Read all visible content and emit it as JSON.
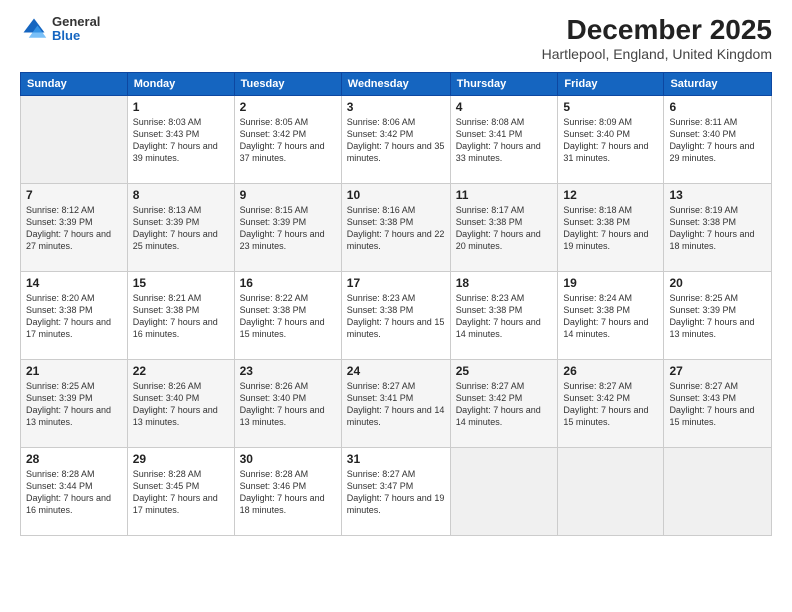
{
  "logo": {
    "general": "General",
    "blue": "Blue"
  },
  "title": "December 2025",
  "location": "Hartlepool, England, United Kingdom",
  "headers": [
    "Sunday",
    "Monday",
    "Tuesday",
    "Wednesday",
    "Thursday",
    "Friday",
    "Saturday"
  ],
  "weeks": [
    [
      {
        "day": "",
        "info": ""
      },
      {
        "day": "1",
        "info": "Sunrise: 8:03 AM\nSunset: 3:43 PM\nDaylight: 7 hours\nand 39 minutes."
      },
      {
        "day": "2",
        "info": "Sunrise: 8:05 AM\nSunset: 3:42 PM\nDaylight: 7 hours\nand 37 minutes."
      },
      {
        "day": "3",
        "info": "Sunrise: 8:06 AM\nSunset: 3:42 PM\nDaylight: 7 hours\nand 35 minutes."
      },
      {
        "day": "4",
        "info": "Sunrise: 8:08 AM\nSunset: 3:41 PM\nDaylight: 7 hours\nand 33 minutes."
      },
      {
        "day": "5",
        "info": "Sunrise: 8:09 AM\nSunset: 3:40 PM\nDaylight: 7 hours\nand 31 minutes."
      },
      {
        "day": "6",
        "info": "Sunrise: 8:11 AM\nSunset: 3:40 PM\nDaylight: 7 hours\nand 29 minutes."
      }
    ],
    [
      {
        "day": "7",
        "info": "Sunrise: 8:12 AM\nSunset: 3:39 PM\nDaylight: 7 hours\nand 27 minutes."
      },
      {
        "day": "8",
        "info": "Sunrise: 8:13 AM\nSunset: 3:39 PM\nDaylight: 7 hours\nand 25 minutes."
      },
      {
        "day": "9",
        "info": "Sunrise: 8:15 AM\nSunset: 3:39 PM\nDaylight: 7 hours\nand 23 minutes."
      },
      {
        "day": "10",
        "info": "Sunrise: 8:16 AM\nSunset: 3:38 PM\nDaylight: 7 hours\nand 22 minutes."
      },
      {
        "day": "11",
        "info": "Sunrise: 8:17 AM\nSunset: 3:38 PM\nDaylight: 7 hours\nand 20 minutes."
      },
      {
        "day": "12",
        "info": "Sunrise: 8:18 AM\nSunset: 3:38 PM\nDaylight: 7 hours\nand 19 minutes."
      },
      {
        "day": "13",
        "info": "Sunrise: 8:19 AM\nSunset: 3:38 PM\nDaylight: 7 hours\nand 18 minutes."
      }
    ],
    [
      {
        "day": "14",
        "info": "Sunrise: 8:20 AM\nSunset: 3:38 PM\nDaylight: 7 hours\nand 17 minutes."
      },
      {
        "day": "15",
        "info": "Sunrise: 8:21 AM\nSunset: 3:38 PM\nDaylight: 7 hours\nand 16 minutes."
      },
      {
        "day": "16",
        "info": "Sunrise: 8:22 AM\nSunset: 3:38 PM\nDaylight: 7 hours\nand 15 minutes."
      },
      {
        "day": "17",
        "info": "Sunrise: 8:23 AM\nSunset: 3:38 PM\nDaylight: 7 hours\nand 15 minutes."
      },
      {
        "day": "18",
        "info": "Sunrise: 8:23 AM\nSunset: 3:38 PM\nDaylight: 7 hours\nand 14 minutes."
      },
      {
        "day": "19",
        "info": "Sunrise: 8:24 AM\nSunset: 3:38 PM\nDaylight: 7 hours\nand 14 minutes."
      },
      {
        "day": "20",
        "info": "Sunrise: 8:25 AM\nSunset: 3:39 PM\nDaylight: 7 hours\nand 13 minutes."
      }
    ],
    [
      {
        "day": "21",
        "info": "Sunrise: 8:25 AM\nSunset: 3:39 PM\nDaylight: 7 hours\nand 13 minutes."
      },
      {
        "day": "22",
        "info": "Sunrise: 8:26 AM\nSunset: 3:40 PM\nDaylight: 7 hours\nand 13 minutes."
      },
      {
        "day": "23",
        "info": "Sunrise: 8:26 AM\nSunset: 3:40 PM\nDaylight: 7 hours\nand 13 minutes."
      },
      {
        "day": "24",
        "info": "Sunrise: 8:27 AM\nSunset: 3:41 PM\nDaylight: 7 hours\nand 14 minutes."
      },
      {
        "day": "25",
        "info": "Sunrise: 8:27 AM\nSunset: 3:42 PM\nDaylight: 7 hours\nand 14 minutes."
      },
      {
        "day": "26",
        "info": "Sunrise: 8:27 AM\nSunset: 3:42 PM\nDaylight: 7 hours\nand 15 minutes."
      },
      {
        "day": "27",
        "info": "Sunrise: 8:27 AM\nSunset: 3:43 PM\nDaylight: 7 hours\nand 15 minutes."
      }
    ],
    [
      {
        "day": "28",
        "info": "Sunrise: 8:28 AM\nSunset: 3:44 PM\nDaylight: 7 hours\nand 16 minutes."
      },
      {
        "day": "29",
        "info": "Sunrise: 8:28 AM\nSunset: 3:45 PM\nDaylight: 7 hours\nand 17 minutes."
      },
      {
        "day": "30",
        "info": "Sunrise: 8:28 AM\nSunset: 3:46 PM\nDaylight: 7 hours\nand 18 minutes."
      },
      {
        "day": "31",
        "info": "Sunrise: 8:27 AM\nSunset: 3:47 PM\nDaylight: 7 hours\nand 19 minutes."
      },
      {
        "day": "",
        "info": ""
      },
      {
        "day": "",
        "info": ""
      },
      {
        "day": "",
        "info": ""
      }
    ]
  ]
}
